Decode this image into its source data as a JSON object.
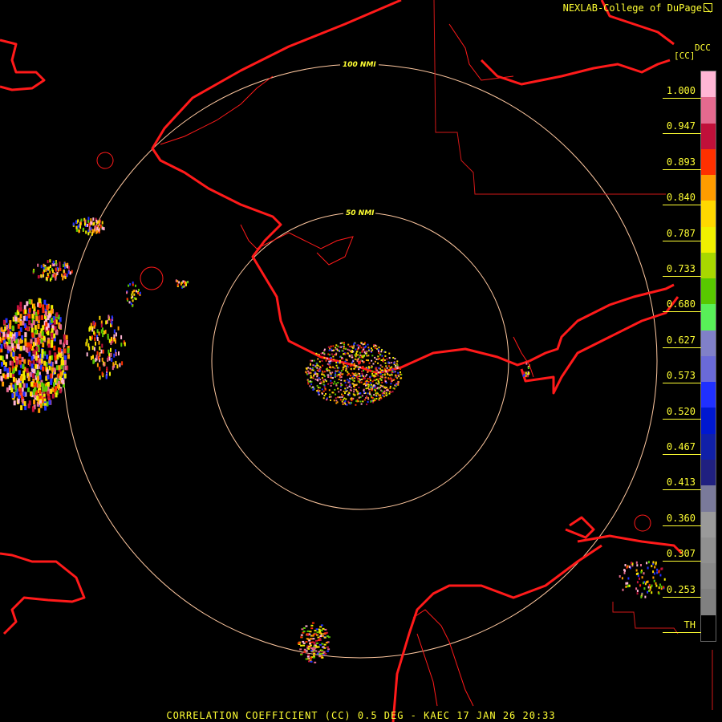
{
  "header": {
    "title": "NEXLAB-College of DuPage"
  },
  "legend": {
    "product": "DCC",
    "unit": "[CC]",
    "labels": [
      "1.000",
      "0.947",
      "0.893",
      "0.840",
      "0.787",
      "0.733",
      "0.680",
      "0.627",
      "0.573",
      "0.520",
      "0.467",
      "0.413",
      "0.360",
      "0.307",
      "0.253",
      "TH"
    ],
    "colors": [
      "#ffb6d5",
      "#e46a8f",
      "#c0103a",
      "#ff3000",
      "#ff9c00",
      "#ffd800",
      "#f0f000",
      "#a8d800",
      "#58c800",
      "#58f058",
      "#8080c8",
      "#6a6ad8",
      "#2030ff",
      "#0018d0",
      "#1020a8",
      "#202080",
      "#7a7a9a",
      "#9a9a9a",
      "#909090",
      "#888888",
      "#808080",
      "#000000"
    ]
  },
  "rings": [
    {
      "label": "50 NMI"
    },
    {
      "label": "100 NMI"
    }
  ],
  "footer": {
    "text": "CORRELATION COEFFICIENT (CC) 0.5 DEG - KAEC 17 JAN 26 20:33"
  },
  "colors": {
    "coastline": "#ff1a1a",
    "ring": "#ffc8a0",
    "text": "#ffff33"
  }
}
